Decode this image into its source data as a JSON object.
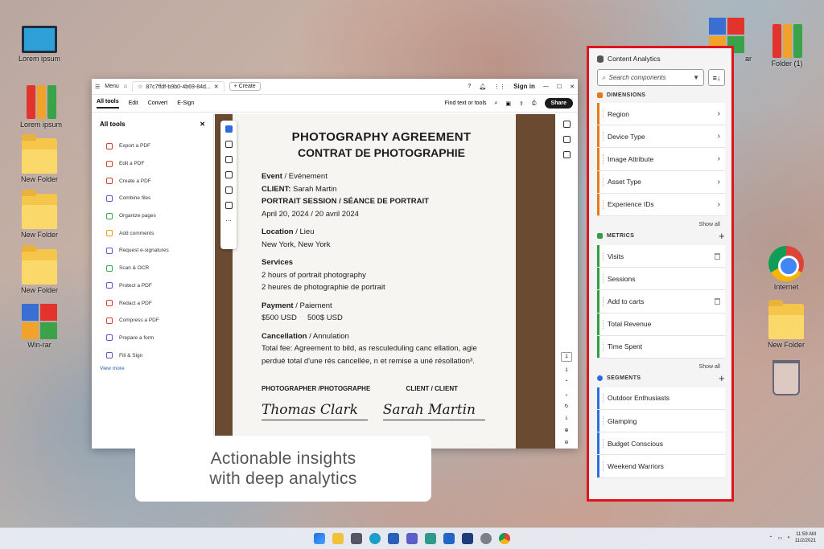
{
  "desktop": {
    "icons_left": [
      {
        "label": "Lorem ipsum",
        "type": "monitor"
      },
      {
        "label": "Lorem ipsum",
        "type": "binders"
      },
      {
        "label": "New Folder",
        "type": "folder"
      },
      {
        "label": "New Folder",
        "type": "folder"
      },
      {
        "label": "New Folder",
        "type": "folder"
      },
      {
        "label": "Win-rar",
        "type": "rar"
      }
    ],
    "icons_right": [
      {
        "label": "ar",
        "type": "rar"
      },
      {
        "label": "Folder (1)",
        "type": "binders"
      },
      {
        "label": "Internet",
        "type": "chrome"
      },
      {
        "label": "New Folder",
        "type": "folder"
      },
      {
        "label": "",
        "type": "trash"
      }
    ]
  },
  "acrobat": {
    "menu_label": "Menu",
    "tab_title": "87c7ffdf-b9b0-4b69-84d...",
    "create_label": "Create",
    "sign_in": "Sign in",
    "menubar": [
      "All tools",
      "Edit",
      "Convert",
      "E-Sign"
    ],
    "find_text": "Find text or tools",
    "share_label": "Share",
    "tools_panel_title": "All tools",
    "tools": [
      {
        "label": "Export a PDF",
        "color": "#d6402e"
      },
      {
        "label": "Edit a PDF",
        "color": "#d6402e"
      },
      {
        "label": "Create a PDF",
        "color": "#d6402e"
      },
      {
        "label": "Combine files",
        "color": "#6d4fd1"
      },
      {
        "label": "Organize pages",
        "color": "#39a845"
      },
      {
        "label": "Add comments",
        "color": "#e3a21a"
      },
      {
        "label": "Request e-signatures",
        "color": "#6d4fd1"
      },
      {
        "label": "Scan & OCR",
        "color": "#39a845"
      },
      {
        "label": "Protect a PDF",
        "color": "#6d4fd1"
      },
      {
        "label": "Redact a PDF",
        "color": "#d6402e"
      },
      {
        "label": "Compress a PDF",
        "color": "#d6402e"
      },
      {
        "label": "Prepare a form",
        "color": "#6d4fd1"
      },
      {
        "label": "Fill & Sign",
        "color": "#6d4fd1"
      }
    ],
    "view_more": "View more",
    "page_number": "1",
    "page_total": "1",
    "document": {
      "title": "PHOTOGRAPHY AGREEMENT",
      "subtitle": "CONTRAT DE PHOTOGRAPHIE",
      "event_h": "Event",
      "event_fr": " / Evénement",
      "client_h": "CLIENT:",
      "client_name": " Sarah Martin",
      "session_h": "PORTRAIT SESSION / SÉANCE DE PORTRAIT",
      "date": "April 20, 2024 / 20 avril 2024",
      "location_h": "Location",
      "location_fr": " / Lieu",
      "location": "New York, New York",
      "services_h": "Services",
      "services_1": "2 hours of portrait photography",
      "services_2": "2 heures de photographie de portrait",
      "payment_h": "Payment",
      "payment_fr": " / Paiement",
      "payment": "$500 USD     500$ USD",
      "cancel_h": "Cancellation",
      "cancel_fr": " / Annulation",
      "cancel_1": "Total fee: Agreement to bild, as resculeduling canc ellation, agie",
      "cancel_2": "perdué total d'une rés cancellée, n et remise a uné résollation³.",
      "sig_label_1": "PHOTOGRAPHER /PHOTOGRAPHE",
      "sig_label_2": "CLIENT / CLIENT",
      "sig_name_1": "Thomas Clark",
      "sig_name_2": "Sarah Martin"
    }
  },
  "overlay": {
    "line1": "Actionable insights",
    "line2": "with deep analytics"
  },
  "analytics": {
    "title": "Content Analytics",
    "search_placeholder": "Search components",
    "dimensions": {
      "heading": "DIMENSIONS",
      "color": "#e8771a",
      "items": [
        "Region",
        "Device Type",
        "Image Attribute",
        "Asset Type",
        "Experience IDs"
      ],
      "show_all": "Show all"
    },
    "metrics": {
      "heading": "METRICS",
      "color": "#2ea043",
      "items": [
        "Visits",
        "Sessions",
        "Add to carts",
        "Total Revenue",
        "Time Spent"
      ],
      "show_all": "Show all"
    },
    "segments": {
      "heading": "SEGMENTS",
      "color": "#2d6cdf",
      "items": [
        "Outdoor Enthusiasts",
        "Glamping",
        "Budget Conscious",
        "Weekend Warriors"
      ]
    }
  },
  "taskbar": {
    "time": "11:59 AM",
    "date": "11/2/2021"
  }
}
